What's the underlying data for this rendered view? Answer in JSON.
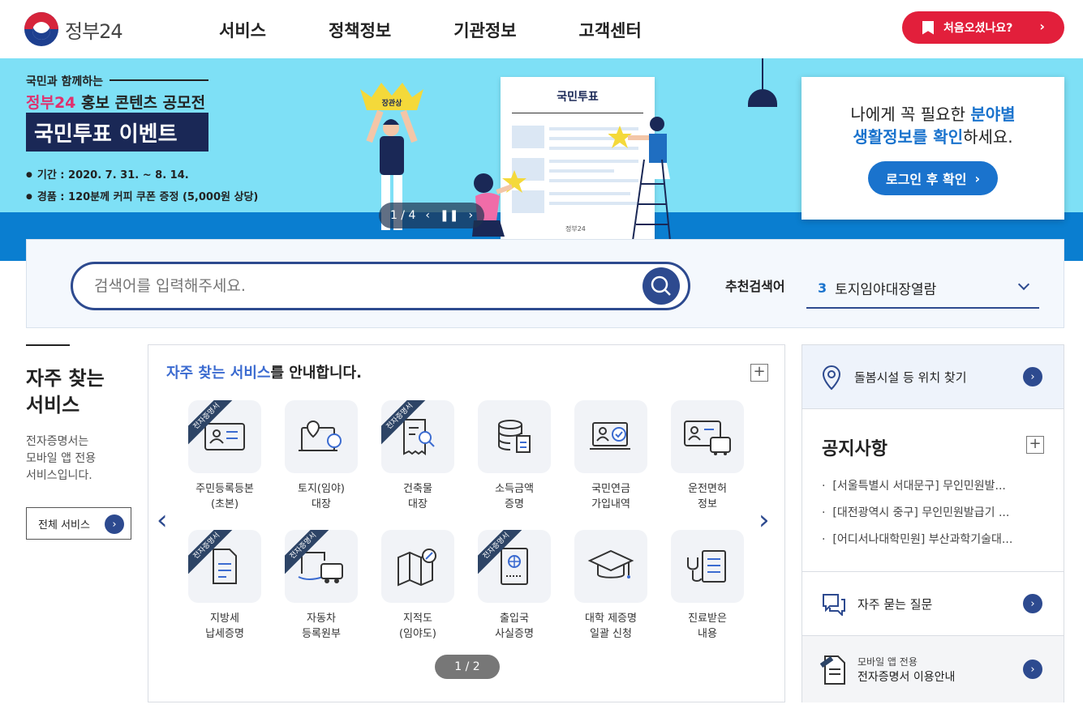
{
  "header": {
    "logo_text": "정부24",
    "nav": [
      "서비스",
      "정책정보",
      "기관정보",
      "고객센터"
    ],
    "first_visit_button": "처음오셨나요?"
  },
  "banner": {
    "subtitle": "국민과 함께하는",
    "title_brand": "정부24",
    "title_rest": " 홍보 콘텐츠 공모전",
    "title_event": "국민투표 이벤트",
    "period": "기간 : 2020. 7. 31. ~ 8. 14.",
    "prize": "경품 : 120분께 커피 쿠폰 증정 (5,000원 상당)",
    "crown_label": "장관상",
    "paper_title": "국민투표",
    "paper_footer": "정부24",
    "pager": "1 / 4",
    "login_card": {
      "line1_a": "나에게 꼭 필요한 ",
      "line1_b": "분야별",
      "line2_a": "생활정보를 확인",
      "line2_b": "하세요.",
      "button": "로그인 후 확인"
    }
  },
  "search": {
    "placeholder": "검색어를 입력해주세요.",
    "recommended_label": "추천검색어",
    "recommended_rank": "3",
    "recommended_value": "토지임야대장열람"
  },
  "frequent": {
    "title_line1": "자주 찾는",
    "title_line2": "서비스",
    "desc_line1": "전자증명서는",
    "desc_line2": "모바일 앱 전용",
    "desc_line3": "서비스입니다.",
    "all_button": "전체 서비스",
    "panel_head_blue": "자주 찾는 서비스",
    "panel_head_rest": "를 안내합니다.",
    "ribbon": "전자증명서",
    "items": [
      {
        "l1": "주민등록등본",
        "l2": "(초본)",
        "icon": "id-card-icon"
      },
      {
        "l1": "토지(임야)",
        "l2": "대장",
        "icon": "land-map-icon"
      },
      {
        "l1": "건축물",
        "l2": "대장",
        "icon": "building-doc-icon"
      },
      {
        "l1": "소득금액",
        "l2": "증명",
        "icon": "database-doc-icon"
      },
      {
        "l1": "국민연금",
        "l2": "가입내역",
        "icon": "pension-icon"
      },
      {
        "l1": "운전면허",
        "l2": "정보",
        "icon": "driver-license-icon"
      },
      {
        "l1": "지방세",
        "l2": "납세증명",
        "icon": "tax-doc-icon"
      },
      {
        "l1": "자동차",
        "l2": "등록원부",
        "icon": "car-doc-icon"
      },
      {
        "l1": "지적도",
        "l2": "(임야도)",
        "icon": "map-search-icon"
      },
      {
        "l1": "출입국",
        "l2": "사실증명",
        "icon": "passport-icon"
      },
      {
        "l1": "대학 제증명",
        "l2": "일괄 신청",
        "icon": "graduation-cap-icon"
      },
      {
        "l1": "진료받은",
        "l2": "내용",
        "icon": "medical-record-icon"
      }
    ],
    "pager": "1 / 2"
  },
  "right": {
    "care": "돌봄시설 등 위치 찾기",
    "notice_title": "공지사항",
    "notices": [
      "[서울특별시 서대문구] 무인민원발...",
      "[대전광역시 중구] 무인민원발급기 ...",
      "[어디서나대학민원] 부산과학기술대..."
    ],
    "faq": "자주 묻는 질문",
    "mobile_small": "모바일 앱 전용",
    "mobile_main": "전자증명서 이용안내"
  }
}
